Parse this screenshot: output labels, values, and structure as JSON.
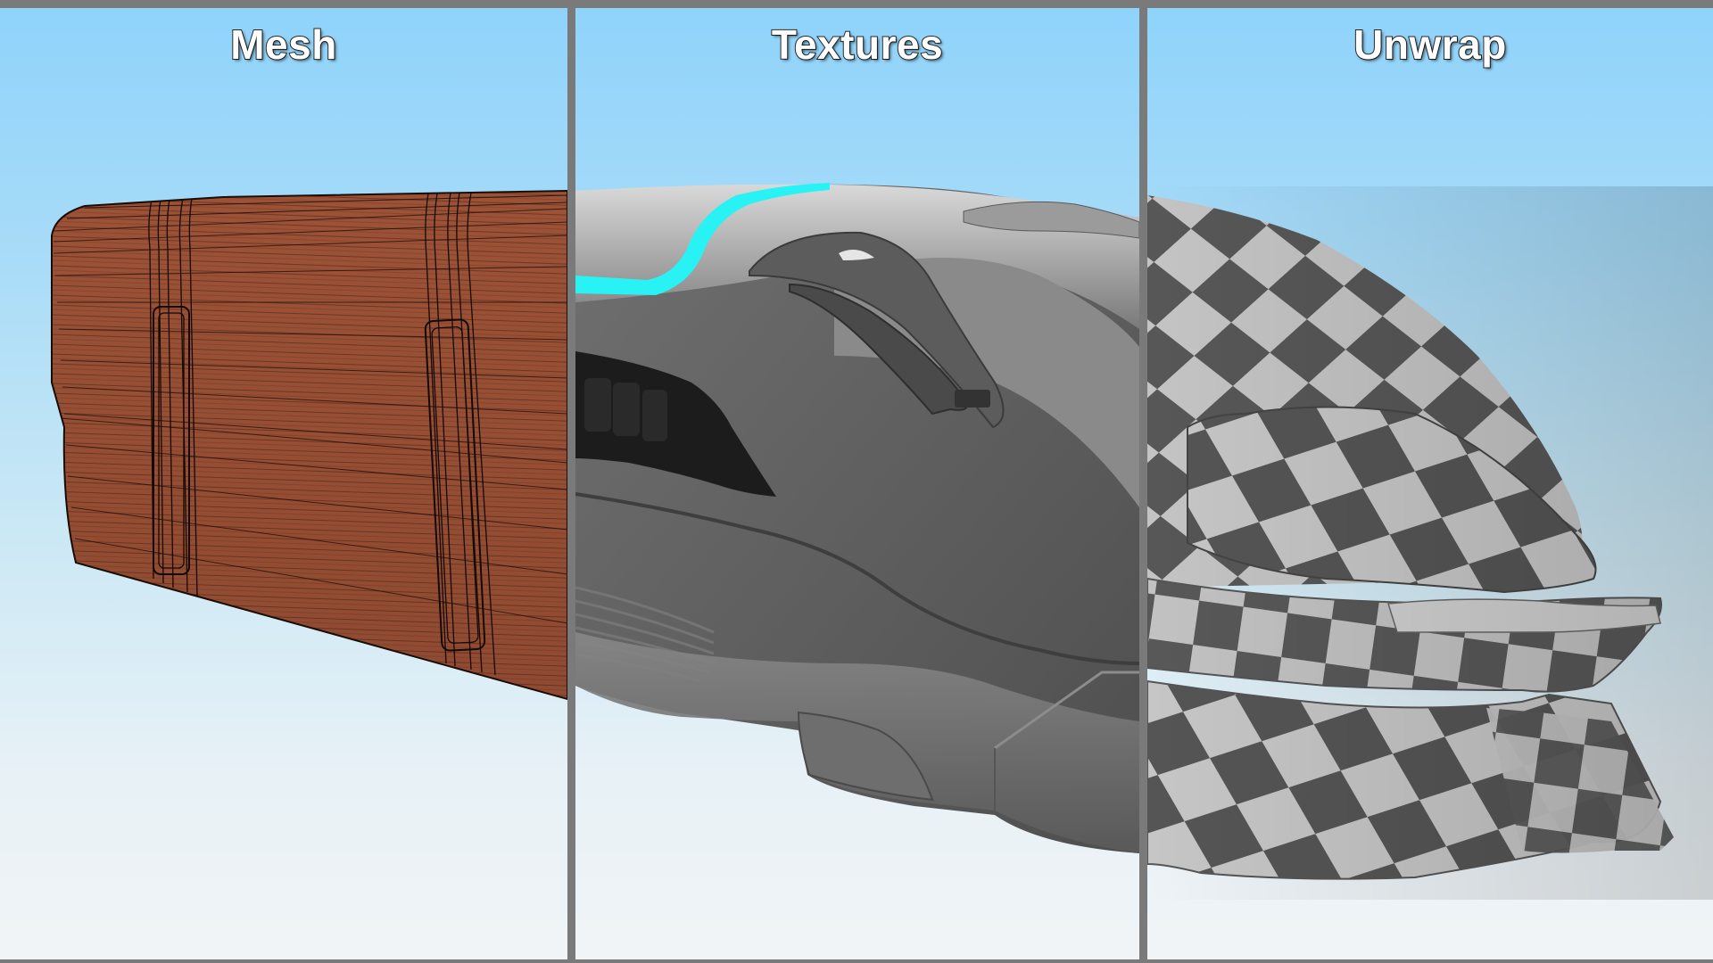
{
  "panels": [
    {
      "id": "mesh",
      "title": "Mesh",
      "render": "wireframe"
    },
    {
      "id": "textures",
      "title": "Textures",
      "render": "shaded"
    },
    {
      "id": "unwrap",
      "title": "Unwrap",
      "render": "uv-checker"
    }
  ],
  "colors": {
    "frame": "#7a7a7a",
    "sky_top": "#8fd3fb",
    "sky_bottom": "#f1f4f7",
    "mesh_fill": "#944c33",
    "mesh_lines": "#1a0c06",
    "body_grey": "#6b6b6b",
    "accent_cyan": "#29f2f5",
    "checker_dark": "#575757",
    "checker_light": "#c4c4c4"
  }
}
